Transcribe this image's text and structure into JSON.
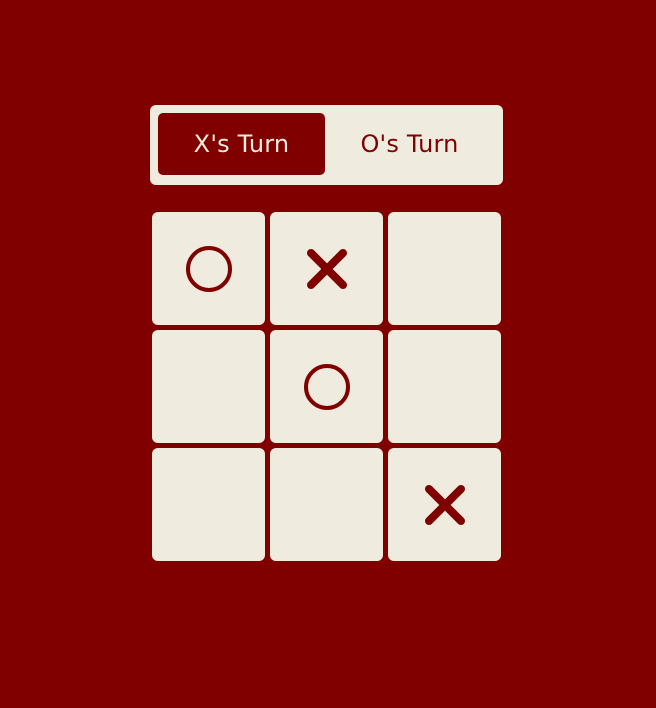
{
  "turn": {
    "x_label": "X's Turn",
    "o_label": "O's Turn",
    "active": "X"
  },
  "board": [
    [
      "O",
      "X",
      ""
    ],
    [
      "",
      "O",
      ""
    ],
    [
      "",
      "",
      "X"
    ]
  ],
  "colors": {
    "background": "#800000",
    "tile": "#f0ebdf",
    "mark": "#800000"
  },
  "icons": {
    "X": "x-mark-icon",
    "O": "o-mark-icon"
  }
}
